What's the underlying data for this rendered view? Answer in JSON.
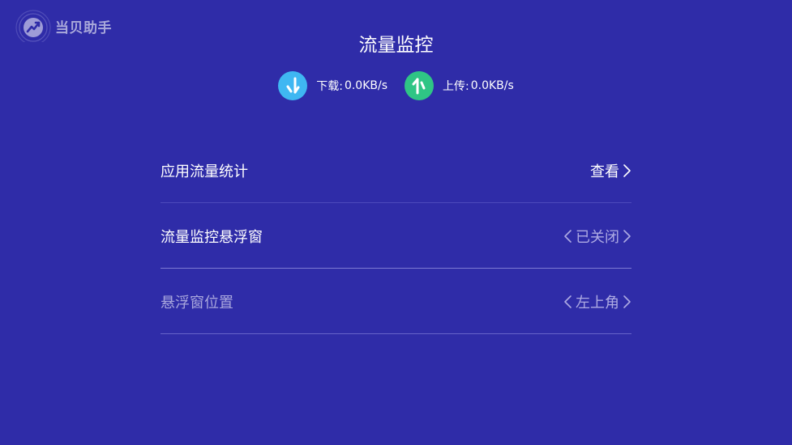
{
  "app": {
    "logo_text": "当贝助手"
  },
  "page": {
    "title": "流量监控"
  },
  "speed": {
    "download_label": "下载:",
    "download_value": "0.0KB/s",
    "upload_label": "上传:",
    "upload_value": "0.0KB/s"
  },
  "settings": {
    "items": [
      {
        "label": "应用流量统计",
        "value": "查看"
      },
      {
        "label": "流量监控悬浮窗",
        "value": "已关闭"
      },
      {
        "label": "悬浮窗位置",
        "value": "左上角"
      }
    ]
  },
  "colors": {
    "background": "#2f2ca8",
    "download_icon": "#3fb7f2",
    "upload_icon": "#2fc585",
    "divider": "#5a57c4"
  },
  "icons": {
    "logo": "dangbei-logo-icon",
    "download": "download-arrow-icon",
    "upload": "upload-arrow-icon",
    "chevron_left": "chevron-left-icon",
    "chevron_right": "chevron-right-icon"
  }
}
